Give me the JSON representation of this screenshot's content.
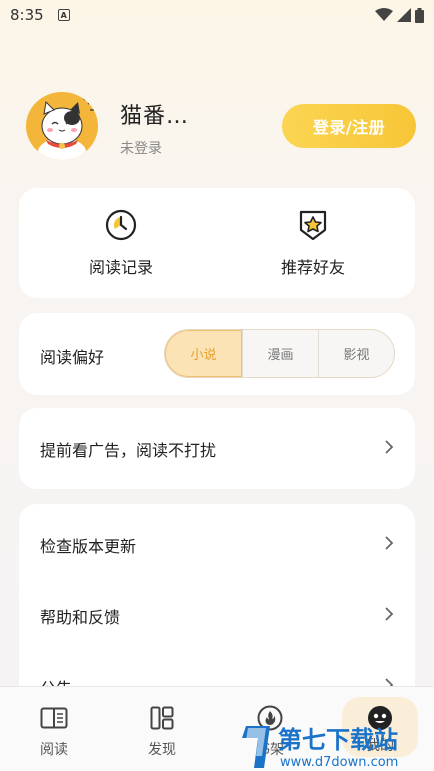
{
  "status_bar": {
    "time": "8:35",
    "notif_glyph": "A"
  },
  "profile": {
    "name": "猫番…",
    "status": "未登录",
    "login_button": "登录/注册"
  },
  "quick_actions": [
    {
      "label": "阅读记录",
      "icon": "clock-icon"
    },
    {
      "label": "推荐好友",
      "icon": "shield-star-icon"
    }
  ],
  "preference": {
    "label": "阅读偏好",
    "options": [
      "小说",
      "漫画",
      "影视"
    ],
    "selected": "小说"
  },
  "ad_row": {
    "label": "提前看广告，阅读不打扰"
  },
  "menu": [
    {
      "label": "检查版本更新"
    },
    {
      "label": "帮助和反馈"
    },
    {
      "label": "公告"
    }
  ],
  "tabs": [
    {
      "label": "阅读",
      "icon": "book-icon"
    },
    {
      "label": "发现",
      "icon": "grid-icon"
    },
    {
      "label": "书架",
      "icon": "flame-icon"
    },
    {
      "label": "我的",
      "icon": "face-icon"
    }
  ],
  "watermark": {
    "title": "第七下载站",
    "url": "www.d7down.com"
  },
  "colors": {
    "accent": "#f7c637",
    "accent_text": "#e5a12f",
    "avatar_bg": "#f3b63a"
  }
}
